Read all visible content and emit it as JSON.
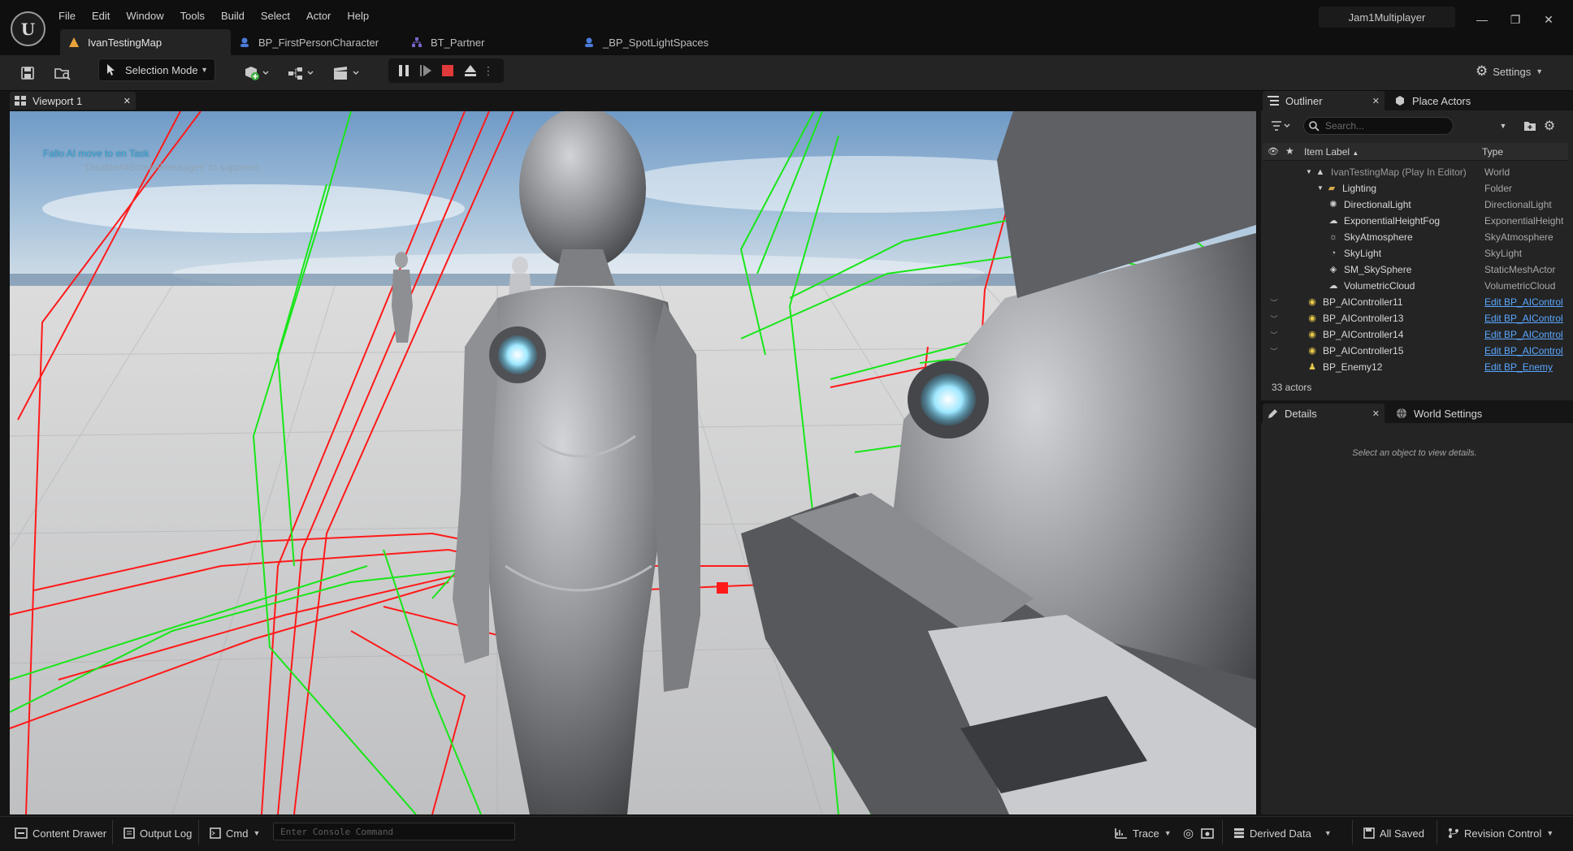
{
  "app": {
    "project_name": "Jam1Multiplayer",
    "logo_glyph": "U"
  },
  "menu": [
    "File",
    "Edit",
    "Window",
    "Tools",
    "Build",
    "Select",
    "Actor",
    "Help"
  ],
  "window_controls": {
    "minimize": "—",
    "maximize": "❐",
    "close": "✕"
  },
  "doc_tabs": [
    {
      "label": "IvanTestingMap",
      "icon": "level-icon",
      "color": "#e8a23b"
    },
    {
      "label": "BP_FirstPersonCharacter",
      "icon": "blueprint-icon",
      "color": "#4a7bd8"
    },
    {
      "label": "BT_Partner",
      "icon": "behavior-tree-icon",
      "color": "#7a63c9"
    },
    {
      "label": "_BP_SpotLightSpaces",
      "icon": "blueprint-icon",
      "color": "#4a7bd8"
    }
  ],
  "toolbar": {
    "selection_mode": "Selection Mode",
    "settings": "Settings",
    "play_state": "playing"
  },
  "viewport": {
    "tab_label": "Viewport 1",
    "message": "Fallo AI move to en Task",
    "suppress_hint": "'DisableAllScreenMessages' to suppress"
  },
  "outliner": {
    "tab_label": "Outliner",
    "place_actors": "Place Actors",
    "search_placeholder": "Search...",
    "col_label": "Item Label",
    "col_type": "Type",
    "rows": [
      {
        "label": "IvanTestingMap (Play In Editor)",
        "type": "World",
        "indent": 1,
        "icon": "world-icon",
        "dim": true
      },
      {
        "label": "Lighting",
        "type": "Folder",
        "indent": 2,
        "icon": "folder-icon"
      },
      {
        "label": "DirectionalLight",
        "type": "DirectionalLight",
        "indent": 3,
        "icon": "directional-light-icon"
      },
      {
        "label": "ExponentialHeightFog",
        "type": "ExponentialHeightFog",
        "indent": 3,
        "icon": "fog-icon"
      },
      {
        "label": "SkyAtmosphere",
        "type": "SkyAtmosphere",
        "indent": 3,
        "icon": "sky-atmosphere-icon"
      },
      {
        "label": "SkyLight",
        "type": "SkyLight",
        "indent": 3,
        "icon": "skylight-icon"
      },
      {
        "label": "SM_SkySphere",
        "type": "StaticMeshActor",
        "indent": 3,
        "icon": "static-mesh-icon"
      },
      {
        "label": "VolumetricCloud",
        "type": "VolumetricCloud",
        "indent": 3,
        "icon": "cloud-icon"
      },
      {
        "label": "BP_AIController11",
        "type": "Edit BP_AIController",
        "indent": 1,
        "icon": "controller-icon",
        "link": true,
        "eye": true
      },
      {
        "label": "BP_AIController13",
        "type": "Edit BP_AIController",
        "indent": 1,
        "icon": "controller-icon",
        "link": true,
        "eye": true
      },
      {
        "label": "BP_AIController14",
        "type": "Edit BP_AIController",
        "indent": 1,
        "icon": "controller-icon",
        "link": true,
        "eye": true
      },
      {
        "label": "BP_AIController15",
        "type": "Edit BP_AIController",
        "indent": 1,
        "icon": "controller-icon",
        "link": true,
        "eye": true
      },
      {
        "label": "BP_Enemy12",
        "type": "Edit BP_Enemy",
        "indent": 1,
        "icon": "pawn-icon",
        "link": true
      }
    ],
    "actor_count": "33 actors"
  },
  "details": {
    "tab_label": "Details",
    "world_settings": "World Settings",
    "empty_hint": "Select an object to view details."
  },
  "statusbar": {
    "content_drawer": "Content Drawer",
    "output_log": "Output Log",
    "cmd": "Cmd",
    "console_placeholder": "Enter Console Command",
    "trace": "Trace",
    "derived_data": "Derived Data",
    "all_saved": "All Saved",
    "revision_control": "Revision Control"
  },
  "colors": {
    "accent_link": "#5aa7ff",
    "message": "#35a6d8",
    "stop_red": "#e03a3a",
    "debug_red": "#ff1a1a",
    "debug_green": "#19e619"
  }
}
